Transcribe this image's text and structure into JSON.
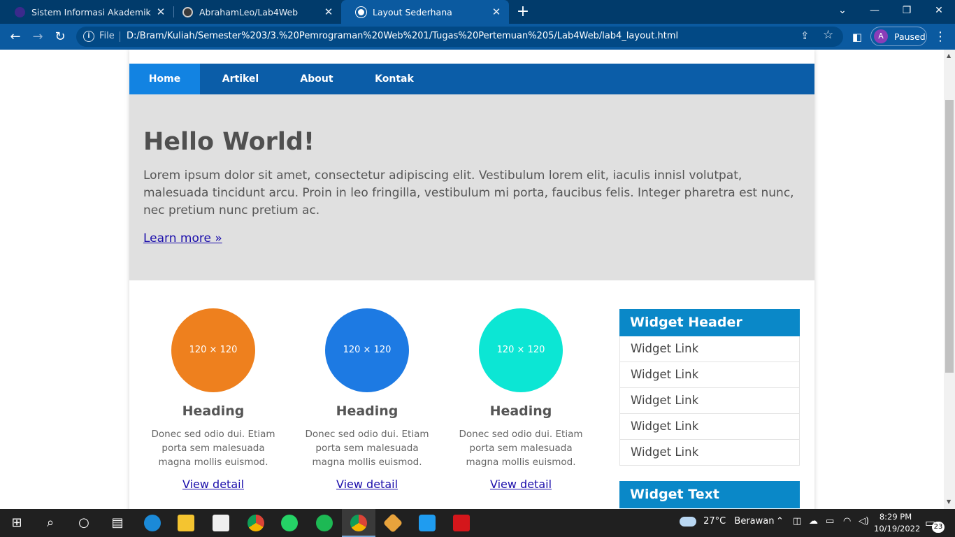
{
  "browser": {
    "tabs": [
      {
        "title": "Sistem Informasi Akademik",
        "icon": "graduation-cap-icon",
        "active": false
      },
      {
        "title": "AbrahamLeo/Lab4Web",
        "icon": "github-icon",
        "active": false
      },
      {
        "title": "Layout Sederhana",
        "icon": "globe-icon",
        "active": true
      }
    ],
    "file_label": "File",
    "url": "D:/Bram/Kuliah/Semester%203/3.%20Pemrograman%20Web%201/Tugas%20Pertemuan%205/Lab4Web/lab4_layout.html",
    "profile_initial": "A",
    "profile_status": "Paused"
  },
  "page": {
    "nav": [
      "Home",
      "Artikel",
      "About",
      "Kontak"
    ],
    "hero": {
      "title": "Hello World!",
      "text": "Lorem ipsum dolor sit amet, consectetur adipiscing elit. Vestibulum lorem elit, iaculis innisl volutpat, malesuada tincidunt arcu. Proin in leo fringilla, vestibulum mi porta, faucibus felis. Integer pharetra est nunc, nec pretium nunc pretium ac.",
      "link": "Learn more »"
    },
    "columns": [
      {
        "placeholder": "120 × 120",
        "color": "#ee7a12",
        "heading": "Heading",
        "text": "Donec sed odio dui. Etiam porta sem malesuada magna mollis euismod.",
        "link": "View detail"
      },
      {
        "placeholder": "120 × 120",
        "color": "#1173e2",
        "heading": "Heading",
        "text": "Donec sed odio dui. Etiam porta sem malesuada magna mollis euismod.",
        "link": "View detail"
      },
      {
        "placeholder": "120 × 120",
        "color": "#00e5d2",
        "heading": "Heading",
        "text": "Donec sed odio dui. Etiam porta sem malesuada magna mollis euismod.",
        "link": "View detail"
      }
    ],
    "widget": {
      "header": "Widget Header",
      "links": [
        "Widget Link",
        "Widget Link",
        "Widget Link",
        "Widget Link",
        "Widget Link"
      ],
      "text_header": "Widget Text"
    }
  },
  "taskbar": {
    "apps": [
      "windows-start-icon",
      "search-icon",
      "cortana-icon",
      "task-view-icon",
      "edge-icon",
      "file-explorer-icon",
      "store-icon",
      "chrome-icon",
      "whatsapp-icon",
      "spotify-icon",
      "chrome-profile-icon",
      "git-icon",
      "vscode-icon",
      "acrobat-icon"
    ],
    "weather_temp": "27°C",
    "weather_desc": "Berawan",
    "time": "8:29 PM",
    "date": "10/19/2022",
    "notification_count": "23"
  },
  "colors": {
    "nav_bg": "#0b5da8",
    "nav_active": "#1283e2",
    "widget_header": "#0a88c8",
    "hero_bg": "#e0e0e0"
  }
}
